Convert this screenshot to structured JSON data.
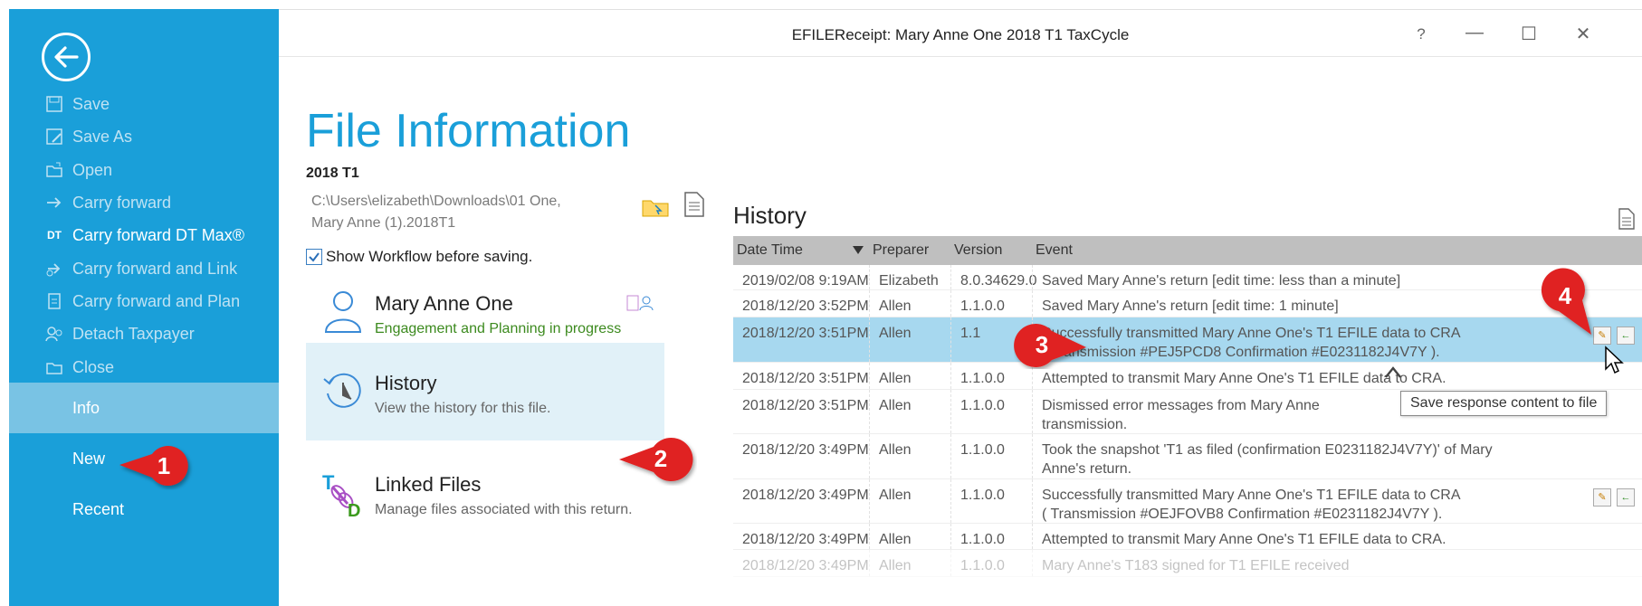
{
  "window": {
    "title": "EFILEReceipt: Mary Anne One 2018 T1 TaxCycle",
    "help_label": "?",
    "minimize_label": "—",
    "maximize_label": "☐",
    "close_label": "✕"
  },
  "sidebar": {
    "bg_color": "#1a9fd9",
    "items": [
      {
        "label": "Save",
        "icon": "save-icon"
      },
      {
        "label": "Save As",
        "icon": "save-as-icon"
      },
      {
        "label": "Open",
        "icon": "open-folder-icon"
      },
      {
        "label": "Carry forward",
        "icon": "carry-forward-icon"
      },
      {
        "label": "Carry forward DT Max®",
        "icon": "dt-max-icon",
        "prefix": "DT"
      },
      {
        "label": "Carry forward and Link",
        "icon": "carry-forward-link-icon"
      },
      {
        "label": "Carry forward and Plan",
        "icon": "carry-forward-plan-icon"
      },
      {
        "label": "Detach Taxpayer",
        "icon": "detach-taxpayer-icon"
      },
      {
        "label": "Close",
        "icon": "close-folder-icon"
      }
    ],
    "tabs": [
      {
        "label": "Info",
        "selected": true
      },
      {
        "label": "New",
        "selected": false
      },
      {
        "label": "Recent",
        "selected": false
      }
    ]
  },
  "info": {
    "title": "File Information",
    "year": "2018 T1",
    "path_line1": "C:\\Users\\elizabeth\\Downloads\\01 One,",
    "path_line2": "Mary Anne (1).2018T1",
    "show_workflow_label": "Show Workflow before saving.",
    "show_workflow_checked": true
  },
  "cards": [
    {
      "title": "Mary Anne One",
      "subtitle": "Engagement and Planning in progress"
    },
    {
      "title": "History",
      "subtitle": "View the history for this file."
    },
    {
      "title": "Linked Files",
      "subtitle": "Manage files associated with this return."
    }
  ],
  "history": {
    "title": "History",
    "columns": [
      "Date Time",
      "Preparer",
      "Version",
      "Event"
    ],
    "rows": [
      {
        "date": "2019/02/08 9:19AM",
        "preparer": "Elizabeth",
        "version": "8.0.34629.0",
        "event1": "Saved Mary Anne's return [edit time: less than a minute]",
        "event2": ""
      },
      {
        "date": "2018/12/20 3:52PM",
        "preparer": "Allen",
        "version": "1.1.0.0",
        "event1": "Saved Mary Anne's return [edit time: 1 minute]",
        "event2": ""
      },
      {
        "date": "2018/12/20 3:51PM",
        "preparer": "Allen",
        "version": "1.1",
        "event1": "Successfully transmitted Mary Anne One's T1 EFILE data to CRA",
        "event2": "( Transmission #PEJ5PCD8 Confirmation #E0231182J4V7Y )."
      },
      {
        "date": "2018/12/20 3:51PM",
        "preparer": "Allen",
        "version": "1.1.0.0",
        "event1": "Attempted to transmit Mary Anne One's T1 EFILE data to CRA.",
        "event2": ""
      },
      {
        "date": "2018/12/20 3:51PM",
        "preparer": "Allen",
        "version": "1.1.0.0",
        "event1": "Dismissed error messages from Mary Anne",
        "event2": "transmission."
      },
      {
        "date": "2018/12/20 3:49PM",
        "preparer": "Allen",
        "version": "1.1.0.0",
        "event1": "Took the snapshot 'T1 as filed (confirmation E0231182J4V7Y)' of Mary",
        "event2": "Anne's return."
      },
      {
        "date": "2018/12/20 3:49PM",
        "preparer": "Allen",
        "version": "1.1.0.0",
        "event1": "Successfully transmitted Mary Anne One's T1 EFILE data to CRA",
        "event2": "( Transmission #OEJFOVB8 Confirmation #E0231182J4V7Y )."
      },
      {
        "date": "2018/12/20 3:49PM",
        "preparer": "Allen",
        "version": "1.1.0.0",
        "event1": "Attempted to transmit Mary Anne One's T1 EFILE data to CRA.",
        "event2": ""
      },
      {
        "date": "2018/12/20 3:49PM",
        "preparer": "Allen",
        "version": "1.1.0.0",
        "event1": "Mary Anne's T183 signed for T1 EFILE received",
        "event2": ""
      }
    ],
    "tooltip": "Save response content to file"
  },
  "callouts": [
    "1",
    "2",
    "3",
    "4"
  ],
  "colors": {
    "accent": "#1a9fd9",
    "selected_row": "#a7d8ef",
    "callout_red": "#e02020"
  }
}
